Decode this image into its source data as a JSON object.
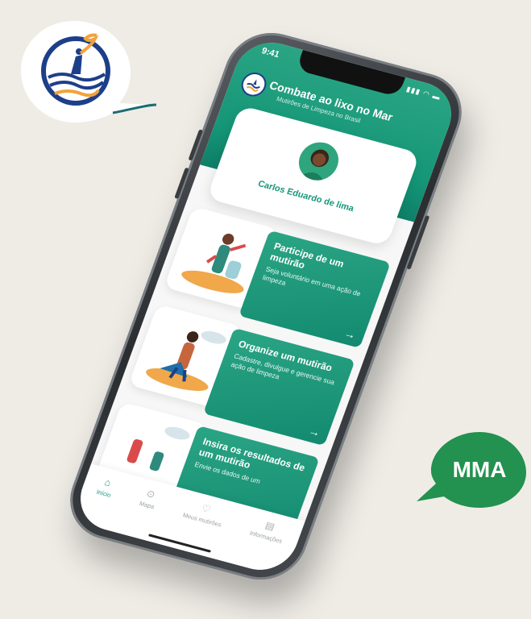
{
  "badges": {
    "mma_text": "MMA"
  },
  "status_bar": {
    "time": "9:41",
    "icons": "▮▮▮ ◠ ▬"
  },
  "header": {
    "title": "Combate ao lixo no Mar",
    "subtitle": "Mutirões de Limpeza no Brasil"
  },
  "profile": {
    "name": "Carlos Eduardo de lima"
  },
  "actions": [
    {
      "title": "Participe de um mutirão",
      "description": "Seja voluntário em uma ação de limpeza",
      "arrow": "→"
    },
    {
      "title": "Organize um mutirão",
      "description": "Cadastre, divulgue e gerencie sua ação de limpeza",
      "arrow": "→"
    },
    {
      "title": "Insira os resultados de um mutirão",
      "description": "Envie os dados de um"
    }
  ],
  "tabs": [
    {
      "label": "Início",
      "icon": "home-icon",
      "glyph": "⌂",
      "active": true
    },
    {
      "label": "Mapa",
      "icon": "map-pin-icon",
      "glyph": "⊙",
      "active": false
    },
    {
      "label": "Meus mutirões",
      "icon": "heart-icon",
      "glyph": "♡",
      "active": false
    },
    {
      "label": "Informações",
      "icon": "document-icon",
      "glyph": "▤",
      "active": false
    }
  ],
  "colors": {
    "primary": "#159677",
    "primary_light": "#2aa584",
    "background": "#efece6",
    "logo_blue": "#1d3f8a",
    "logo_orange": "#f2a23a"
  }
}
